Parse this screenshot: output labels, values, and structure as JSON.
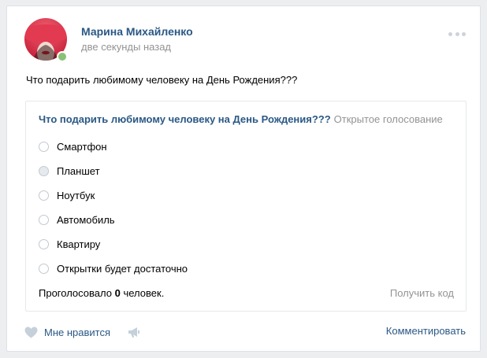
{
  "post": {
    "author_name": "Марина Михайленко",
    "time": "две секунды назад",
    "text": "Что подарить любимому человеку на День Рождения???"
  },
  "poll": {
    "question": "Что подарить любимому человеку на День Рождения???",
    "type_label": "Открытое голосование",
    "options": [
      {
        "label": "Смартфон"
      },
      {
        "label": "Планшет"
      },
      {
        "label": "Ноутбук"
      },
      {
        "label": "Автомобиль"
      },
      {
        "label": "Квартиру"
      },
      {
        "label": "Открытки будет достаточно"
      }
    ],
    "votes_prefix": "Проголосовало",
    "votes_count": "0",
    "votes_suffix": "человек.",
    "get_code_label": "Получить код"
  },
  "actions": {
    "like_label": "Мне нравится",
    "comment_label": "Комментировать"
  },
  "icons": {
    "more": "more-horizontal-icon",
    "like": "heart-icon",
    "share": "megaphone-icon"
  },
  "colors": {
    "link": "#2a5885",
    "muted": "#939393",
    "online": "#8ac176",
    "background": "#edeef0"
  }
}
